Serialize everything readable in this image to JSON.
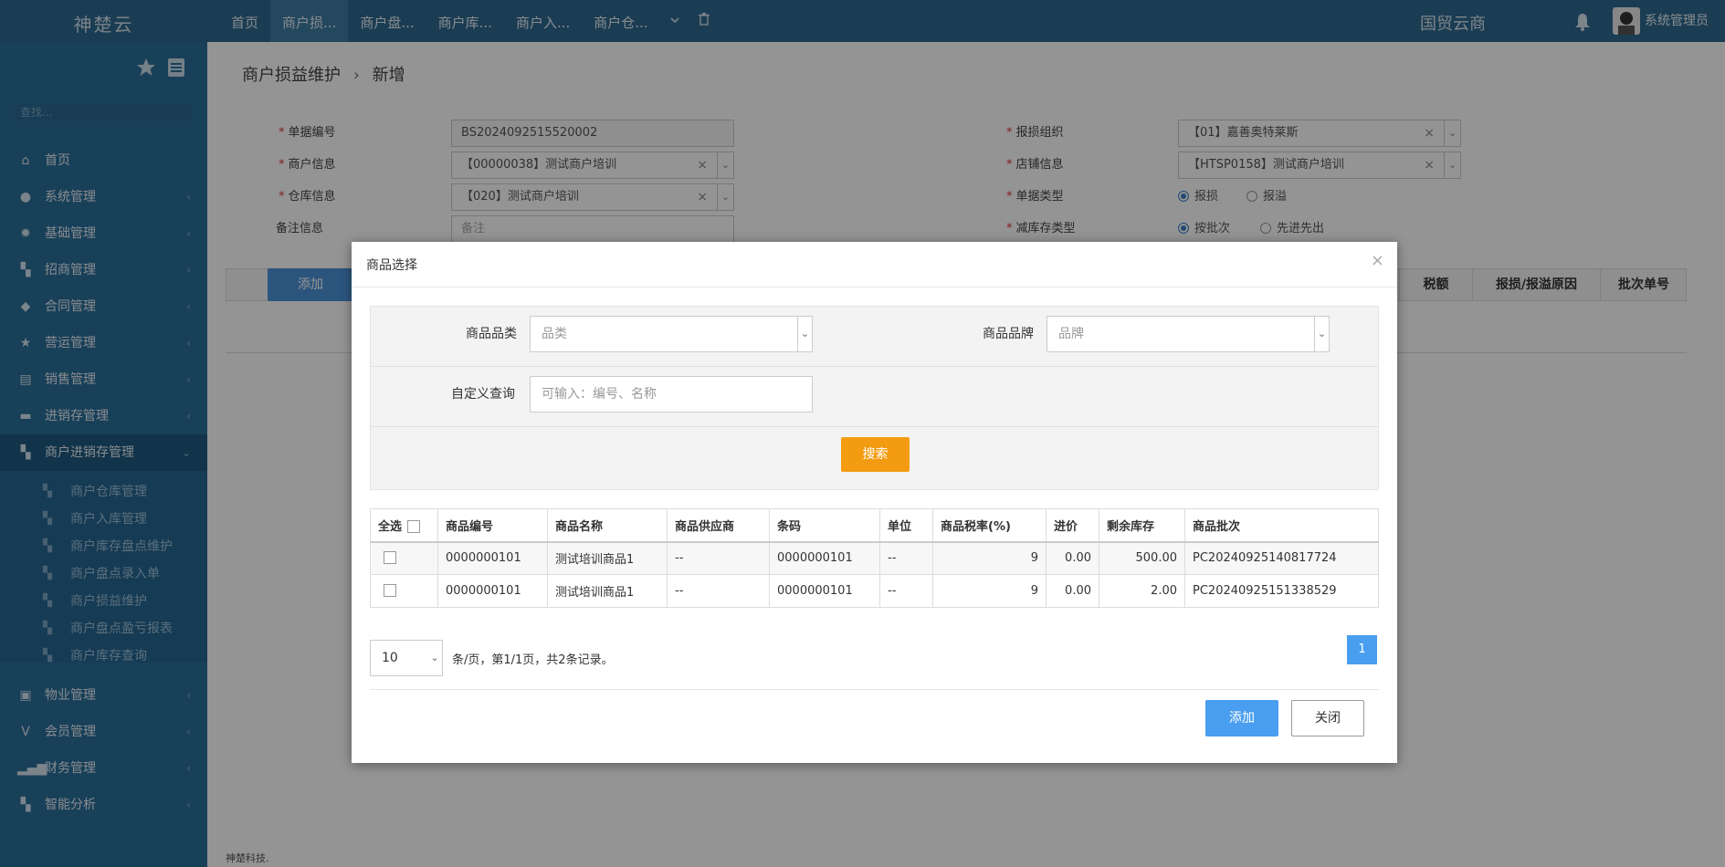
{
  "topbar": {
    "brand": "神楚云",
    "nav": [
      "首页",
      "商户损...",
      "商户盘...",
      "商户库...",
      "商户入...",
      "商户仓..."
    ],
    "company": "国贸云商",
    "user": "系统管理员"
  },
  "sidebar": {
    "search_placeholder": "查找...",
    "items": [
      {
        "label": "首页",
        "icon": "home-icon"
      },
      {
        "label": "系统管理",
        "icon": "user-icon"
      },
      {
        "label": "基础管理",
        "icon": "gear-icon"
      },
      {
        "label": "招商管理",
        "icon": "windows-icon"
      },
      {
        "label": "合同管理",
        "icon": "tag-icon"
      },
      {
        "label": "营运管理",
        "icon": "star-icon"
      },
      {
        "label": "销售管理",
        "icon": "chart-icon"
      },
      {
        "label": "进销存管理",
        "icon": "truck-icon"
      },
      {
        "label": "商户进销存管理",
        "icon": "windows-icon"
      }
    ],
    "subitems": [
      "商户仓库管理",
      "商户入库管理",
      "商户库存盘点维护",
      "商户盘点录入单",
      "商户损益维护",
      "商户盘点盈亏报表",
      "商户库存查询"
    ],
    "items_after": [
      {
        "label": "物业管理",
        "icon": "briefcase-icon"
      },
      {
        "label": "会员管理",
        "icon": "vip-icon"
      },
      {
        "label": "财务管理",
        "icon": "bars-icon"
      },
      {
        "label": "智能分析",
        "icon": "windows-icon"
      }
    ]
  },
  "main": {
    "breadcrumb": "商户损益维护",
    "breadcrumb_sep": "›",
    "breadcrumb_current": "新增",
    "form": {
      "doc_no_label": "单据编号",
      "doc_no_value": "BS2024092515520002",
      "merchant_label": "商户信息",
      "merchant_value": "【00000038】测试商户培训",
      "warehouse_label": "仓库信息",
      "warehouse_value": "【020】测试商户培训",
      "remark_label": "备注信息",
      "remark_placeholder": "备注",
      "org_label": "报损组织",
      "org_value": "【01】嘉善奥特莱斯",
      "shop_label": "店铺信息",
      "shop_value": "【HTSP0158】测试商户培训",
      "doc_type_label": "单据类型",
      "doc_type_options": [
        "报损",
        "报溢"
      ],
      "stock_type_label": "减库存类型",
      "stock_type_options": [
        "按批次",
        "先进先出"
      ]
    },
    "add_button": "添加",
    "table_headers_visible": [
      "税额",
      "报损/报溢原因",
      "批次单号"
    ],
    "footer": "神楚科技."
  },
  "modal": {
    "title": "商品选择",
    "category_label": "商品品类",
    "category_placeholder": "品类",
    "brand_label": "商品品牌",
    "brand_placeholder": "品牌",
    "custom_label": "自定义查询",
    "custom_placeholder": "可输入：编号、名称",
    "search_button": "搜索",
    "table": {
      "headers": [
        "全选",
        "商品编号",
        "商品名称",
        "商品供应商",
        "条码",
        "单位",
        "商品税率(%)",
        "进价",
        "剩余库存",
        "商品批次"
      ],
      "rows": [
        [
          "0000000101",
          "测试培训商品1",
          "--",
          "0000000101",
          "--",
          "9",
          "0.00",
          "500.00",
          "PC20240925140817724"
        ],
        [
          "0000000101",
          "测试培训商品1",
          "--",
          "0000000101",
          "--",
          "9",
          "0.00",
          "2.00",
          "PC20240925151338529"
        ]
      ]
    },
    "page_size": "10",
    "pager_text": "条/页，第1/1页，共2条记录。",
    "current_page": "1",
    "confirm_button": "添加",
    "close_button": "关闭"
  }
}
